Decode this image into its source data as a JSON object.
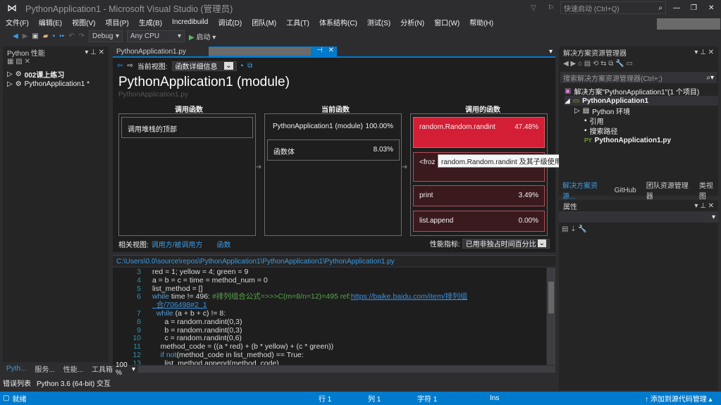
{
  "window": {
    "title": "PythonApplication1 - Microsoft Visual Studio (管理员)",
    "quick_launch": "快速启动 (Ctrl+Q)"
  },
  "menu": [
    "文件(F)",
    "编辑(E)",
    "视图(V)",
    "项目(P)",
    "生成(B)",
    "Incredibuild",
    "调试(D)",
    "团队(M)",
    "工具(T)",
    "体系结构(C)",
    "测试(S)",
    "分析(N)",
    "窗口(W)",
    "帮助(H)"
  ],
  "toolbar": {
    "config": "Debug",
    "platform": "Any CPU",
    "start": "启动"
  },
  "left_panel": {
    "title": "Python 性能",
    "items": [
      "002课上练习",
      "PythonApplication1 *"
    ],
    "tabs": [
      "Pyth...",
      "服务...",
      "性能...",
      "工具箱"
    ]
  },
  "doc_tabs": [
    "PythonApplication1.py"
  ],
  "perf": {
    "current_view_label": "当前视图:",
    "current_view": "函数详细信息",
    "title": "PythonApplication1 (module)",
    "subtitle": "PythonApplication1.py",
    "callers_header": "调用函数",
    "current_header": "当前函数",
    "callees_header": "调用的函数",
    "caller": "调用堆栈的顶部",
    "current": {
      "name": "PythonApplication1 (module)",
      "pct": "100.00%"
    },
    "body": {
      "name": "函数体",
      "pct": "8.03%"
    },
    "callees": [
      {
        "name": "random.Random.randint",
        "pct": "47.48%"
      },
      {
        "name": "<froz",
        "pct": ""
      },
      {
        "name": "print",
        "pct": "3.49%"
      },
      {
        "name": "list.append",
        "pct": "0.00%"
      }
    ],
    "tooltip": "random.Random.randint 及其子级使用了 47.48% 的 CPU 时间",
    "related_label": "相关视图:",
    "related_links": [
      "调用方/被调用方",
      "函数"
    ],
    "metric_label": "性能指标:",
    "metric": "已用非独占时间百分比"
  },
  "code": {
    "path": "C:\\Users\\0.0\\source\\repos\\PythonApplication1\\PythonApplication1\\PythonApplication1.py",
    "zoom": "100 %",
    "lines": [
      {
        "n": "3",
        "t": "red = 1; yellow = 4; green = 9"
      },
      {
        "n": "4",
        "t": "a = b = c = time = method_num = 0"
      },
      {
        "n": "5",
        "t": "list_method = []"
      },
      {
        "n": "6",
        "kw": "while",
        "t": " time != 496: ",
        "cm": "#排列组合公式=>>>C(m=8/n=12)=495 ref:",
        "lnk": "https://baike.baidu.com/item/排列组"
      },
      {
        "n": "",
        "lnk": "  合/706498#2_1"
      },
      {
        "n": "7",
        "kw": "  while",
        "t": " (a + b + c) != 8:"
      },
      {
        "n": "8",
        "t": "      a = random.randint(0,3)"
      },
      {
        "n": "9",
        "t": "      b = random.randint(0,3)"
      },
      {
        "n": "10",
        "t": "      c = random.randint(0,6)"
      },
      {
        "n": "11",
        "t": "    method_code = ((a * red) + (b * yellow) + (c * green))"
      },
      {
        "n": "12",
        "kw": "    if not",
        "t": "(method_code in list_method) == True:"
      },
      {
        "n": "13",
        "t": "      list_method.append(method_code)"
      }
    ]
  },
  "solution": {
    "title": "解决方案资源管理器",
    "search": "搜索解决方案资源管理器(Ctrl+;)",
    "items": [
      "解决方案\"PythonApplication1\"(1 个项目)",
      "PythonApplication1",
      "Python 环境",
      "引用",
      "搜索路径",
      "PythonApplication1.py"
    ],
    "tabs": [
      "解决方案资源...",
      "GitHub",
      "团队资源管理器",
      "类视图"
    ]
  },
  "properties": {
    "title": "属性"
  },
  "bottom_tabs": [
    "错误列表",
    "Python 3.6 (64-bit) 交互"
  ],
  "status": {
    "ready": "就绪",
    "line": "行 1",
    "col": "列 1",
    "char": "字符 1",
    "ins": "Ins",
    "source": "添加到源代码管理"
  },
  "colors": {
    "accent": "#007acc",
    "hot": "#d41e35"
  }
}
